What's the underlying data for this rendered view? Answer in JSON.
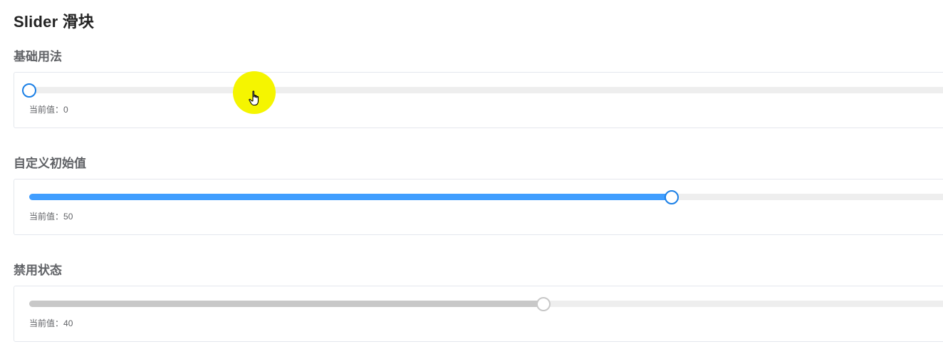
{
  "page": {
    "title": "Slider 滑块"
  },
  "sections": [
    {
      "title": "基础用法",
      "value_label": "当前值：",
      "value": "0",
      "fraction": 0.0,
      "disabled": false
    },
    {
      "title": "自定义初始值",
      "value_label": "当前值：",
      "value": "50",
      "fraction": 0.5,
      "disabled": false
    },
    {
      "title": "禁用状态",
      "value_label": "当前值：",
      "value": "40",
      "fraction": 0.4,
      "disabled": true
    }
  ],
  "colors": {
    "active_fill": "#409eff",
    "thumb_border": "#1a7fe6",
    "disabled_fill": "#c8c8c8",
    "track": "#eeeeee",
    "cursor_highlight": "#f5f500"
  },
  "cursor": {
    "icon": "hand-pointer-icon"
  }
}
